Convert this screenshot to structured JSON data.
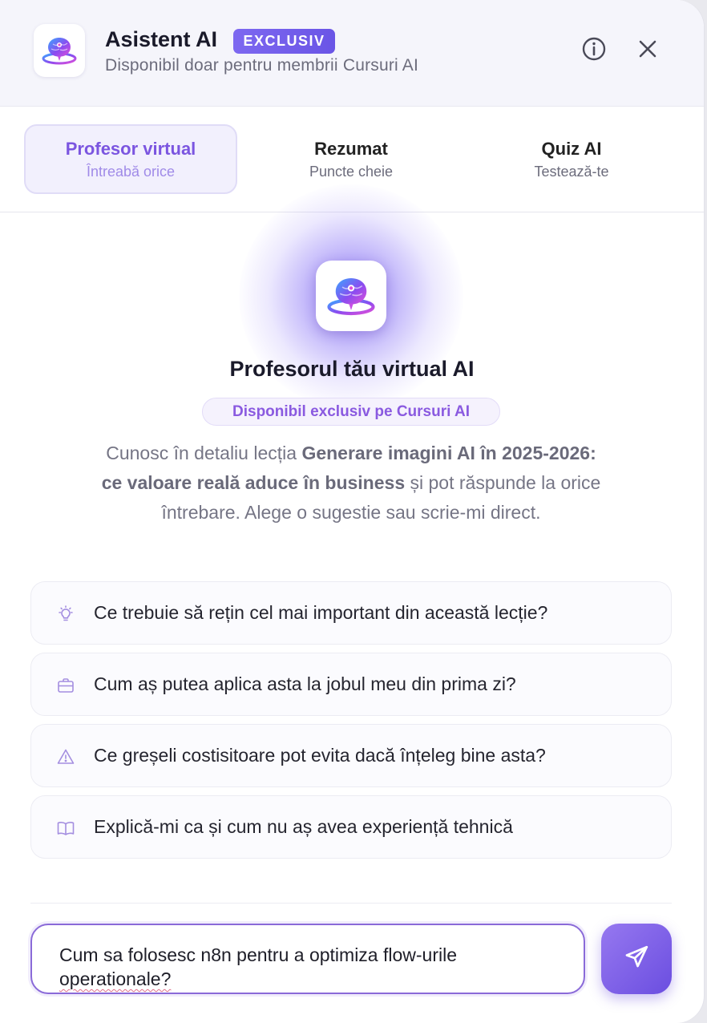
{
  "header": {
    "title": "Asistent AI",
    "badge": "EXCLUSIV",
    "subtitle": "Disponibil doar pentru membrii Cursuri AI",
    "info_icon": "info-icon",
    "close_icon": "close-icon",
    "logo_icon": "ai-brain-icon"
  },
  "tabs": [
    {
      "label": "Profesor virtual",
      "sub": "Întreabă orice",
      "active": true
    },
    {
      "label": "Rezumat",
      "sub": "Puncte cheie",
      "active": false
    },
    {
      "label": "Quiz AI",
      "sub": "Testează-te",
      "active": false
    }
  ],
  "hero": {
    "icon": "ai-brain-icon",
    "title": "Profesorul tău virtual AI",
    "pill": "Disponibil exclusiv pe Cursuri AI",
    "desc_prefix": "Cunosc în detaliu lecția ",
    "desc_bold": "Generare imagini AI în 2025-2026: ce valoare reală aduce în business",
    "desc_suffix": " și pot răspunde la orice întrebare. Alege o sugestie sau scrie-mi direct."
  },
  "suggestions": [
    {
      "icon": "lightbulb-icon",
      "text": "Ce trebuie să rețin cel mai important din această lecție?"
    },
    {
      "icon": "briefcase-icon",
      "text": "Cum aș putea aplica asta la jobul meu din prima zi?"
    },
    {
      "icon": "warning-icon",
      "text": "Ce greșeli costisitoare pot evita dacă înțeleg bine asta?"
    },
    {
      "icon": "book-icon",
      "text": "Explică-mi ca și cum nu aș avea experiență tehnică"
    }
  ],
  "input": {
    "line1": "Cum sa folosesc n8n pentru a optimiza flow-urile",
    "line2": "operationale?"
  },
  "send_icon": "send-icon",
  "colors": {
    "accent": "#7b55e0",
    "badge": "#6a55e6",
    "send_button": "#7a5ce6"
  }
}
